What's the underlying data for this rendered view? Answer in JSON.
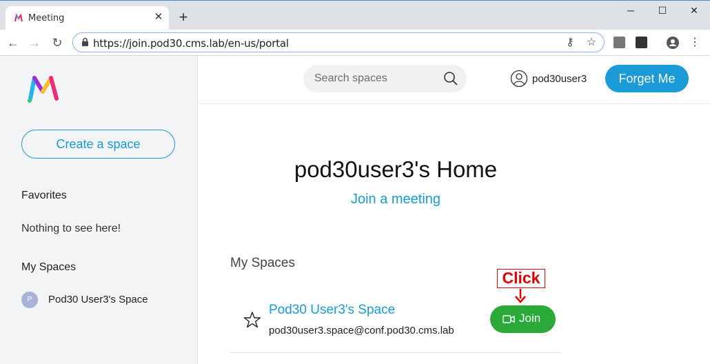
{
  "browser": {
    "tab_title": "Meeting",
    "url": "https://join.pod30.cms.lab/en-us/portal"
  },
  "sidebar": {
    "create_space_label": "Create a space",
    "favorites_heading": "Favorites",
    "favorites_empty": "Nothing to see here!",
    "my_spaces_heading": "My Spaces",
    "spaces": [
      {
        "avatar_letter": "P",
        "label": "Pod30 User3's Space"
      }
    ]
  },
  "header": {
    "search_placeholder": "Search spaces",
    "username": "pod30user3",
    "forget_me_label": "Forget Me"
  },
  "main": {
    "home_title": "pod30user3's Home",
    "join_meeting_link": "Join a meeting",
    "my_spaces_heading": "My Spaces",
    "space": {
      "title": "Pod30 User3's Space",
      "uri": "pod30user3.space@conf.pod30.cms.lab",
      "join_label": "Join"
    },
    "annotation": "Click"
  },
  "colors": {
    "accent": "#1a9ad6",
    "join_green": "#2baa3a",
    "annotation_red": "#e00000",
    "sidebar_bg": "#f3f4f6"
  }
}
